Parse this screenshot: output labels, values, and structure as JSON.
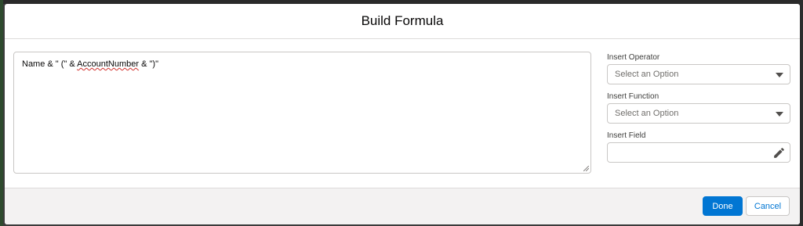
{
  "modal": {
    "title": "Build Formula"
  },
  "formula": {
    "prefix": "Name & \" (\" & ",
    "spell_word": "AccountNumber",
    "suffix": " & \")\""
  },
  "side_panel": {
    "operator": {
      "label": "Insert Operator",
      "selected": "Select an Option"
    },
    "function": {
      "label": "Insert Function",
      "selected": "Select an Option"
    },
    "field": {
      "label": "Insert Field",
      "value": ""
    }
  },
  "footer": {
    "done_label": "Done",
    "cancel_label": "Cancel"
  },
  "colors": {
    "brand": "#0176d3",
    "footer_bg": "#f3f2f2",
    "overlay": "#3b3b3b"
  },
  "icons": {
    "operator_caret": "chevron-down-icon",
    "function_caret": "chevron-down-icon",
    "field_picker": "pencil-icon"
  }
}
